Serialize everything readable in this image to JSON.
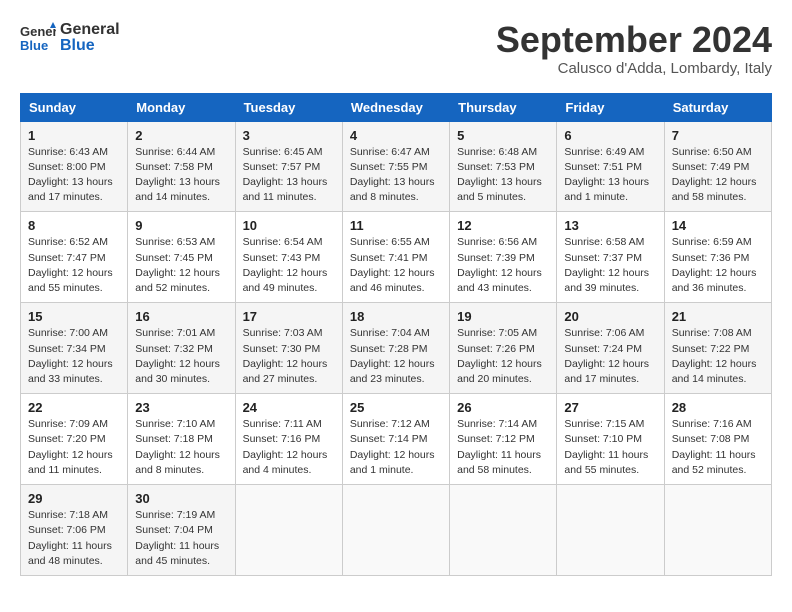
{
  "header": {
    "logo_line1": "General",
    "logo_line2": "Blue",
    "month": "September 2024",
    "location": "Calusco d'Adda, Lombardy, Italy"
  },
  "weekdays": [
    "Sunday",
    "Monday",
    "Tuesday",
    "Wednesday",
    "Thursday",
    "Friday",
    "Saturday"
  ],
  "weeks": [
    [
      {
        "day": 1,
        "info": "Sunrise: 6:43 AM\nSunset: 8:00 PM\nDaylight: 13 hours and 17 minutes."
      },
      {
        "day": 2,
        "info": "Sunrise: 6:44 AM\nSunset: 7:58 PM\nDaylight: 13 hours and 14 minutes."
      },
      {
        "day": 3,
        "info": "Sunrise: 6:45 AM\nSunset: 7:57 PM\nDaylight: 13 hours and 11 minutes."
      },
      {
        "day": 4,
        "info": "Sunrise: 6:47 AM\nSunset: 7:55 PM\nDaylight: 13 hours and 8 minutes."
      },
      {
        "day": 5,
        "info": "Sunrise: 6:48 AM\nSunset: 7:53 PM\nDaylight: 13 hours and 5 minutes."
      },
      {
        "day": 6,
        "info": "Sunrise: 6:49 AM\nSunset: 7:51 PM\nDaylight: 13 hours and 1 minute."
      },
      {
        "day": 7,
        "info": "Sunrise: 6:50 AM\nSunset: 7:49 PM\nDaylight: 12 hours and 58 minutes."
      }
    ],
    [
      {
        "day": 8,
        "info": "Sunrise: 6:52 AM\nSunset: 7:47 PM\nDaylight: 12 hours and 55 minutes."
      },
      {
        "day": 9,
        "info": "Sunrise: 6:53 AM\nSunset: 7:45 PM\nDaylight: 12 hours and 52 minutes."
      },
      {
        "day": 10,
        "info": "Sunrise: 6:54 AM\nSunset: 7:43 PM\nDaylight: 12 hours and 49 minutes."
      },
      {
        "day": 11,
        "info": "Sunrise: 6:55 AM\nSunset: 7:41 PM\nDaylight: 12 hours and 46 minutes."
      },
      {
        "day": 12,
        "info": "Sunrise: 6:56 AM\nSunset: 7:39 PM\nDaylight: 12 hours and 43 minutes."
      },
      {
        "day": 13,
        "info": "Sunrise: 6:58 AM\nSunset: 7:37 PM\nDaylight: 12 hours and 39 minutes."
      },
      {
        "day": 14,
        "info": "Sunrise: 6:59 AM\nSunset: 7:36 PM\nDaylight: 12 hours and 36 minutes."
      }
    ],
    [
      {
        "day": 15,
        "info": "Sunrise: 7:00 AM\nSunset: 7:34 PM\nDaylight: 12 hours and 33 minutes."
      },
      {
        "day": 16,
        "info": "Sunrise: 7:01 AM\nSunset: 7:32 PM\nDaylight: 12 hours and 30 minutes."
      },
      {
        "day": 17,
        "info": "Sunrise: 7:03 AM\nSunset: 7:30 PM\nDaylight: 12 hours and 27 minutes."
      },
      {
        "day": 18,
        "info": "Sunrise: 7:04 AM\nSunset: 7:28 PM\nDaylight: 12 hours and 23 minutes."
      },
      {
        "day": 19,
        "info": "Sunrise: 7:05 AM\nSunset: 7:26 PM\nDaylight: 12 hours and 20 minutes."
      },
      {
        "day": 20,
        "info": "Sunrise: 7:06 AM\nSunset: 7:24 PM\nDaylight: 12 hours and 17 minutes."
      },
      {
        "day": 21,
        "info": "Sunrise: 7:08 AM\nSunset: 7:22 PM\nDaylight: 12 hours and 14 minutes."
      }
    ],
    [
      {
        "day": 22,
        "info": "Sunrise: 7:09 AM\nSunset: 7:20 PM\nDaylight: 12 hours and 11 minutes."
      },
      {
        "day": 23,
        "info": "Sunrise: 7:10 AM\nSunset: 7:18 PM\nDaylight: 12 hours and 8 minutes."
      },
      {
        "day": 24,
        "info": "Sunrise: 7:11 AM\nSunset: 7:16 PM\nDaylight: 12 hours and 4 minutes."
      },
      {
        "day": 25,
        "info": "Sunrise: 7:12 AM\nSunset: 7:14 PM\nDaylight: 12 hours and 1 minute."
      },
      {
        "day": 26,
        "info": "Sunrise: 7:14 AM\nSunset: 7:12 PM\nDaylight: 11 hours and 58 minutes."
      },
      {
        "day": 27,
        "info": "Sunrise: 7:15 AM\nSunset: 7:10 PM\nDaylight: 11 hours and 55 minutes."
      },
      {
        "day": 28,
        "info": "Sunrise: 7:16 AM\nSunset: 7:08 PM\nDaylight: 11 hours and 52 minutes."
      }
    ],
    [
      {
        "day": 29,
        "info": "Sunrise: 7:18 AM\nSunset: 7:06 PM\nDaylight: 11 hours and 48 minutes."
      },
      {
        "day": 30,
        "info": "Sunrise: 7:19 AM\nSunset: 7:04 PM\nDaylight: 11 hours and 45 minutes."
      },
      null,
      null,
      null,
      null,
      null
    ]
  ]
}
